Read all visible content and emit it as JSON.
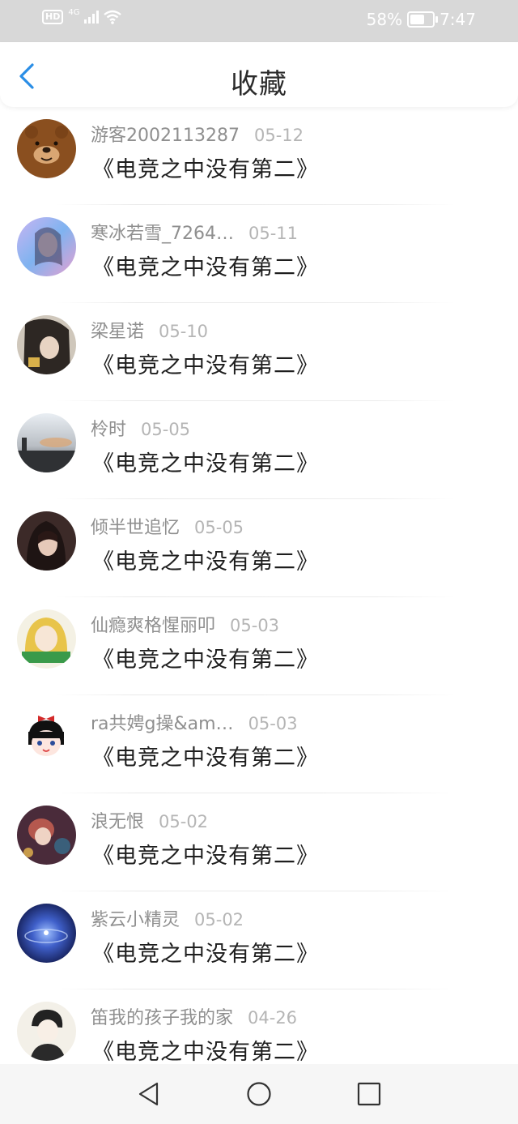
{
  "status_bar": {
    "hd": "HD",
    "network": "4G",
    "battery_percent": "58%",
    "battery_level": 0.58,
    "time": "7:47"
  },
  "header": {
    "title": "收藏",
    "back_icon": "chevron-left-icon",
    "accent_color": "#2a8ee6"
  },
  "favorites": [
    {
      "user": "游客2002113287",
      "date": "05-12",
      "title": "《电竞之中没有第二》"
    },
    {
      "user": "寒冰若雪_7264…",
      "date": "05-11",
      "title": "《电竞之中没有第二》"
    },
    {
      "user": "梁星诺",
      "date": "05-10",
      "title": "《电竞之中没有第二》"
    },
    {
      "user": "柃时",
      "date": "05-05",
      "title": "《电竞之中没有第二》"
    },
    {
      "user": "倾半世追忆",
      "date": "05-05",
      "title": "《电竞之中没有第二》"
    },
    {
      "user": "仙瘾爽格惺丽叩",
      "date": "05-03",
      "title": "《电竞之中没有第二》"
    },
    {
      "user": "ra共娉g操&am…",
      "date": "05-03",
      "title": "《电竞之中没有第二》"
    },
    {
      "user": "浪无恨",
      "date": "05-02",
      "title": "《电竞之中没有第二》"
    },
    {
      "user": "紫云小精灵",
      "date": "05-02",
      "title": "《电竞之中没有第二》"
    },
    {
      "user": "笛我的孩子我的家",
      "date": "04-26",
      "title": "《电竞之中没有第二》"
    }
  ],
  "system_nav": {
    "back_icon": "triangle-back-icon",
    "home_icon": "circle-home-icon",
    "recents_icon": "square-recents-icon"
  }
}
